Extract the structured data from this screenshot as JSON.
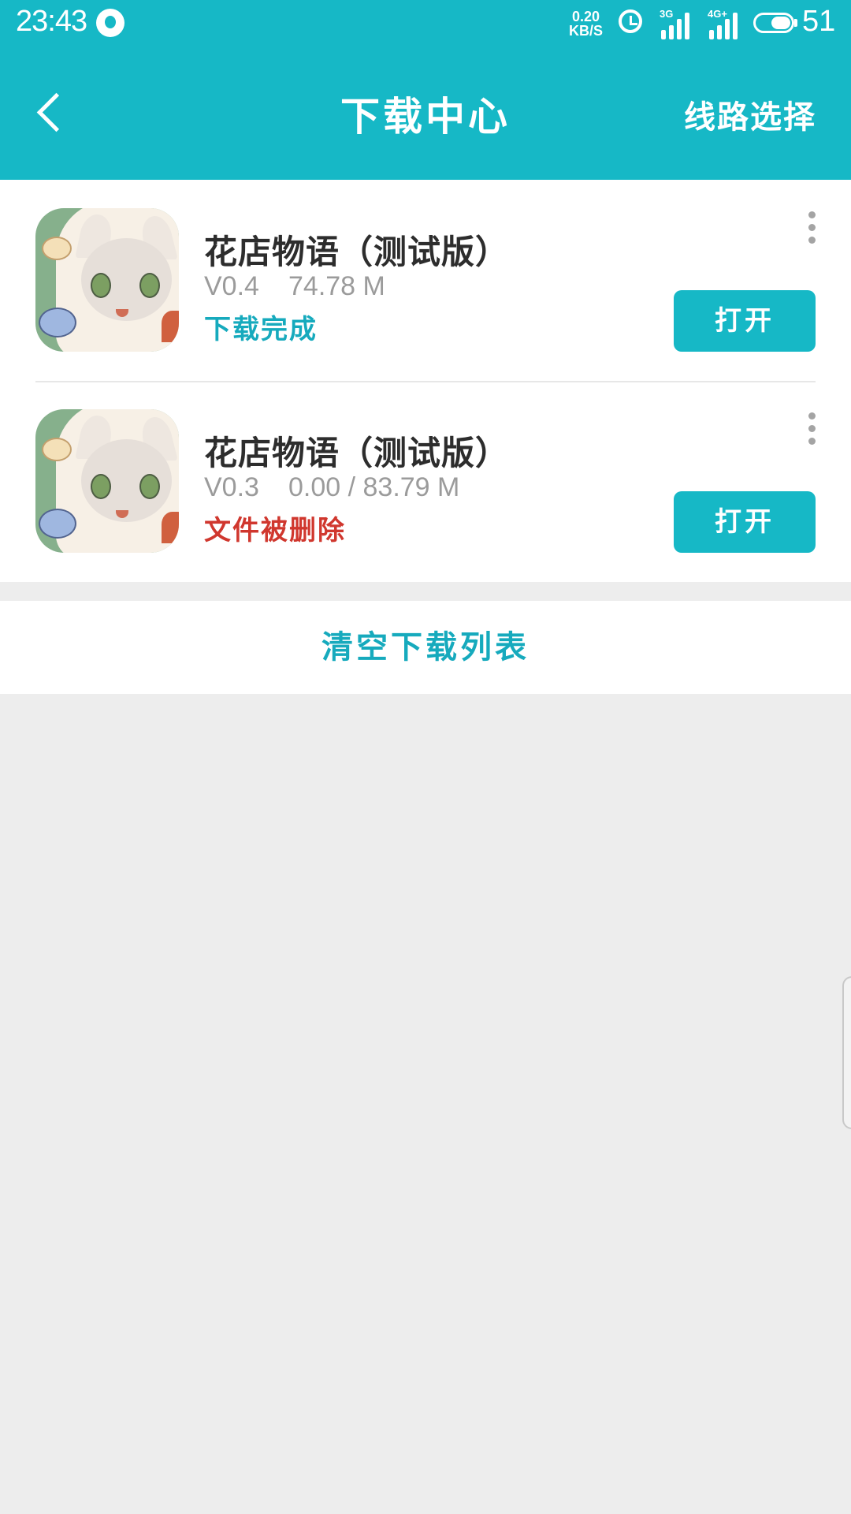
{
  "status_bar": {
    "time": "23:43",
    "net_speed_value": "0.20",
    "net_speed_unit": "KB/S",
    "signal_1_label": "3G",
    "signal_2_label": "4G+",
    "battery_text": "51",
    "icons": [
      "notification-drop-icon",
      "alarm-clock-icon",
      "cell-signal-icon",
      "battery-icon"
    ]
  },
  "header": {
    "title": "下载中心",
    "route_select_label": "线路选择",
    "back_icon": "chevron-left-icon",
    "background_color": "#16b8c6"
  },
  "downloads": [
    {
      "title": "花店物语（测试版）",
      "version": "V0.4",
      "size": "74.78 M",
      "status": "下载完成",
      "status_color": "#16aabd",
      "action_label": "打开"
    },
    {
      "title": "花店物语（测试版）",
      "version": "V0.3",
      "size": "0.00 / 83.79 M",
      "status": "文件被删除",
      "status_color": "#d0372e",
      "action_label": "打开"
    }
  ],
  "footer": {
    "clear_label": "清空下载列表"
  },
  "colors": {
    "accent": "#16b8c6",
    "page_background": "#ededed",
    "status_error": "#d0372e"
  }
}
